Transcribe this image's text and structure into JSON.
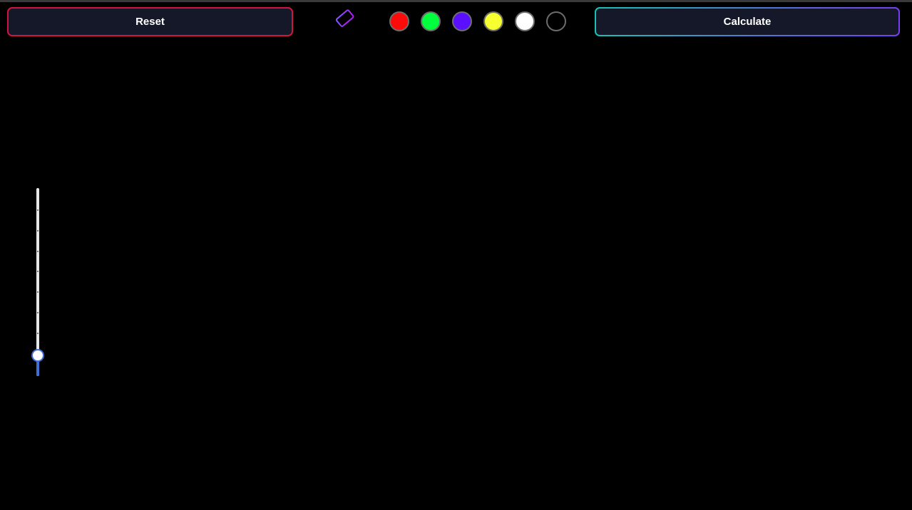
{
  "toolbar": {
    "reset_label": "Reset",
    "calculate_label": "Calculate",
    "eraser_icon": "eraser-icon"
  },
  "palette": {
    "colors": [
      {
        "name": "red",
        "hex": "#ff0a0a"
      },
      {
        "name": "green",
        "hex": "#00ff3c"
      },
      {
        "name": "purple",
        "hex": "#5a10ff"
      },
      {
        "name": "yellow",
        "hex": "#f8ff30"
      },
      {
        "name": "white",
        "hex": "#ffffff"
      },
      {
        "name": "black",
        "hex": "#000000"
      }
    ]
  },
  "brush_size_slider": {
    "orientation": "vertical",
    "level_fraction": 0.11
  },
  "theme": {
    "background": "#000000",
    "button_bg": "#141828",
    "reset_border": "#d0163e",
    "calculate_gradient": [
      "#18c2b0",
      "#7a3cf0"
    ],
    "slider_accent": "#3f6fd6"
  }
}
